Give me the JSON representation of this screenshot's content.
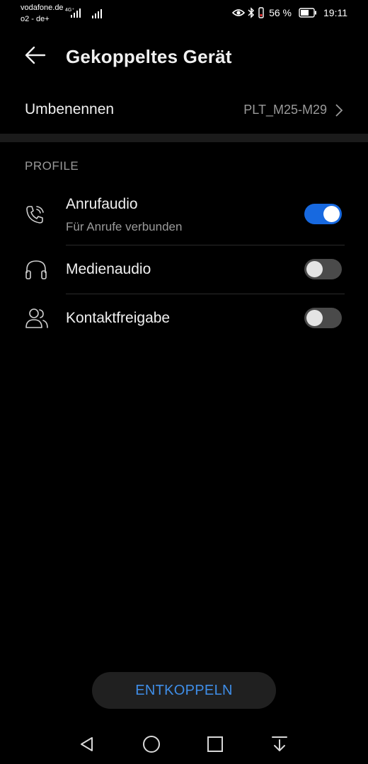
{
  "status_bar": {
    "carrier_1": "vodafone.de",
    "carrier_2": "o2 - de+",
    "network_type": "4G⁺",
    "battery_percent": "56 %",
    "time": "19:11",
    "icons": [
      "signal-icon",
      "eye-icon",
      "bluetooth-icon",
      "vibrate-icon",
      "battery-icon"
    ]
  },
  "header": {
    "title": "Gekoppeltes Gerät",
    "back_icon": "arrow-left-icon"
  },
  "rename": {
    "label": "Umbenennen",
    "value": "PLT_M25-M29"
  },
  "profiles": {
    "section_label": "PROFILE",
    "items": [
      {
        "title": "Anrufaudio",
        "subtitle": "Für Anrufe verbunden",
        "icon": "phone-call-icon",
        "enabled": true
      },
      {
        "title": "Medienaudio",
        "subtitle": "",
        "icon": "headphones-icon",
        "enabled": false
      },
      {
        "title": "Kontaktfreigabe",
        "subtitle": "",
        "icon": "contacts-icon",
        "enabled": false
      }
    ]
  },
  "disconnect_label": "ENTKOPPELN",
  "colors": {
    "accent": "#1769e0",
    "link": "#3f8ee8",
    "background": "#000000",
    "secondary_text": "#9a9a9a"
  },
  "nav_bar": [
    "back-triangle-icon",
    "home-circle-icon",
    "recents-square-icon",
    "notifications-pull-icon"
  ]
}
